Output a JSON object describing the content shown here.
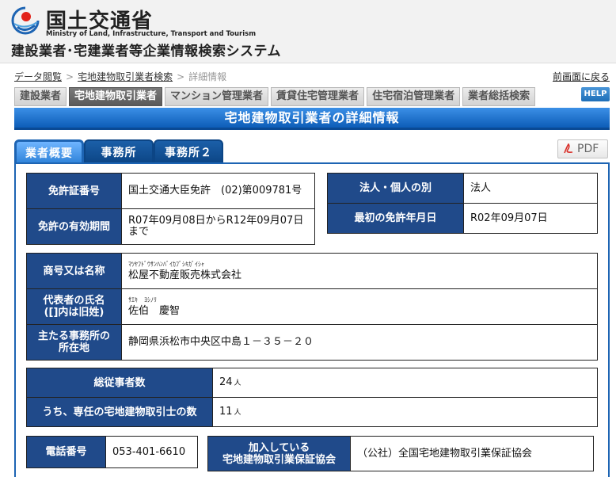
{
  "header": {
    "ministry_name": "国土交通省",
    "ministry_en": "Ministry of Land, Infrastructure, Transport and Tourism",
    "system_title": "建設業者･宅建業者等企業情報検索システム"
  },
  "breadcrumb": {
    "items": [
      "データ閲覧",
      "宅地建物取引業者検索",
      "詳細情報"
    ],
    "back_label": "前画面に戻る"
  },
  "category_tabs": [
    "建設業者",
    "宅地建物取引業者",
    "マンション管理業者",
    "賃貸住宅管理業者",
    "住宅宿泊管理業者",
    "業者総括検索"
  ],
  "help_label": "HELP",
  "page_title": "宅地建物取引業者の詳細情報",
  "sub_tabs": [
    "業者概要",
    "事務所",
    "事務所２"
  ],
  "pdf_label": "PDF",
  "license": {
    "number_label": "免許証番号",
    "number_value": "国土交通大臣免許　(02)第009781号",
    "period_label": "免許の有効期間",
    "period_value": "R07年09月08日からR12年09月07日まで"
  },
  "entity": {
    "type_label": "法人・個人の別",
    "type_value": "法人",
    "first_license_label": "最初の免許年月日",
    "first_license_value": "R02年09月07日"
  },
  "company": {
    "name_label": "商号又は名称",
    "name_kana": "ﾏﾂﾔﾌﾄﾞｳｻﾝﾊﾝﾊﾞｲｶﾌﾞｼｷｶﾞｲｼｬ",
    "name_value": "松屋不動産販売株式会社",
    "rep_label_1": "代表者の氏名",
    "rep_label_2": "([]内は旧姓)",
    "rep_kana": "ｻｴｷ　ﾖｼﾉﾘ",
    "rep_value": "佐伯　慶智",
    "office_label_1": "主たる事務所の",
    "office_label_2": "所在地",
    "office_value": "静岡県浜松市中央区中島１－３５－２０"
  },
  "staff": {
    "total_label": "総従事者数",
    "total_value": "24",
    "agents_label": "うち、専任の宅地建物取引士の数",
    "agents_value": "11",
    "unit": "人"
  },
  "contact": {
    "phone_label": "電話番号",
    "phone_value": "053-401-6610",
    "assoc_label_1": "加入している",
    "assoc_label_2": "宅地建物取引業保証協会",
    "assoc_value": "（公社）全国宅地建物取引業保証協会"
  },
  "colors": {
    "header_cell": "#204a8a",
    "title_bar": "#1f76d2",
    "tab_dark": "#0c4585"
  }
}
